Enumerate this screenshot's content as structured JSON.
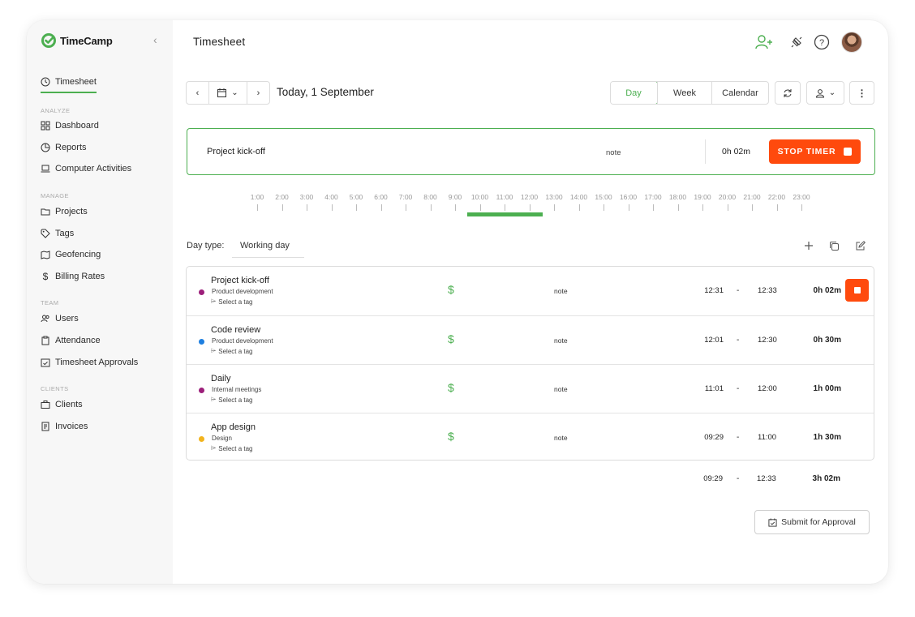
{
  "app": {
    "name": "TimeCamp",
    "accent": "#4caf50",
    "danger": "#ff4a0d"
  },
  "sidebar": {
    "timesheet": "Timesheet",
    "sections": [
      {
        "title": "ANALYZE",
        "items": [
          "Dashboard",
          "Reports",
          "Computer Activities"
        ]
      },
      {
        "title": "MANAGE",
        "items": [
          "Projects",
          "Tags",
          "Geofencing",
          "Billing Rates"
        ]
      },
      {
        "title": "TEAM",
        "items": [
          "Users",
          "Attendance",
          "Timesheet Approvals"
        ]
      },
      {
        "title": "CLIENTS",
        "items": [
          "Clients",
          "Invoices"
        ]
      }
    ]
  },
  "header": {
    "title": "Timesheet"
  },
  "toolbar": {
    "date_label": "Today, 1 September",
    "views": [
      "Day",
      "Week",
      "Calendar"
    ],
    "active_view": "Day"
  },
  "timer": {
    "task": "Project kick-off",
    "note": "note",
    "duration": "0h 02m",
    "stop_label": "STOP TIMER"
  },
  "timeline": {
    "hours": [
      "1:00",
      "2:00",
      "3:00",
      "4:00",
      "5:00",
      "6:00",
      "7:00",
      "8:00",
      "9:00",
      "10:00",
      "11:00",
      "12:00",
      "13:00",
      "14:00",
      "15:00",
      "16:00",
      "17:00",
      "18:00",
      "19:00",
      "20:00",
      "21:00",
      "22:00",
      "23:00"
    ],
    "tracked": {
      "start_hour": 9.5,
      "end_hour": 12.55
    }
  },
  "day_type": {
    "label": "Day type:",
    "value": "Working day"
  },
  "entries": [
    {
      "title": "Project kick-off",
      "project": "Product development",
      "tag": "Select a tag",
      "color": "#9c1f7a",
      "billing": "$",
      "note": "note",
      "start": "12:31",
      "dash": "-",
      "end": "12:33",
      "duration": "0h 02m",
      "running": true
    },
    {
      "title": "Code review",
      "project": "Product development",
      "tag": "Select a tag",
      "color": "#1e7fe0",
      "billing": "$",
      "note": "note",
      "start": "12:01",
      "dash": "-",
      "end": "12:30",
      "duration": "0h 30m",
      "running": false
    },
    {
      "title": "Daily",
      "project": "Internal meetings",
      "tag": "Select a tag",
      "color": "#9c1f7a",
      "billing": "$",
      "note": "note",
      "start": "11:01",
      "dash": "-",
      "end": "12:00",
      "duration": "1h 00m",
      "running": false
    },
    {
      "title": "App design",
      "project": "Design",
      "tag": "Select a tag",
      "color": "#f2b31d",
      "billing": "$",
      "note": "note",
      "start": "09:29",
      "dash": "-",
      "end": "11:00",
      "duration": "1h 30m",
      "running": false
    }
  ],
  "totals": {
    "start": "09:29",
    "dash": "-",
    "end": "12:33",
    "duration": "3h 02m"
  },
  "submit": {
    "label": "Submit for Approval"
  }
}
